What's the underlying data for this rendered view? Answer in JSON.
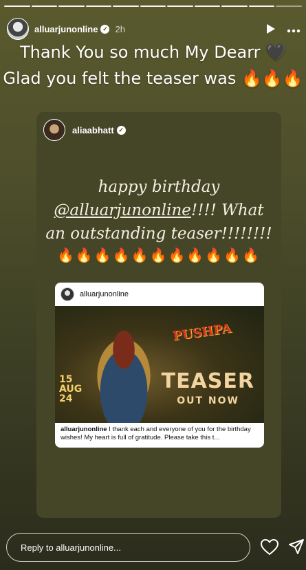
{
  "story": {
    "progress": {
      "segments": 11,
      "active_segment": 11
    },
    "author": {
      "username": "alluarjunonline",
      "verified": true,
      "time_ago": "2h",
      "avatar_icon": "avatar-icon"
    },
    "controls": {
      "play_icon": "play-icon",
      "more_icon": "more-options-icon"
    },
    "overlay": {
      "line1": "Thank You so much My Dearr 🖤",
      "line2": "Glad you felt the teaser was 🔥🔥🔥"
    },
    "shared_post": {
      "author": {
        "username": "aliaabhatt",
        "verified": true
      },
      "message": {
        "line1": "happy birthday",
        "mention": "@alluarjunonline",
        "line2_suffix": "!!!! What",
        "line3": "an outstanding teaser!!!!!!!!",
        "emojis": "🔥🔥🔥🔥🔥🔥🔥🔥🔥🔥🔥"
      },
      "embedded_post": {
        "username": "alluarjunonline",
        "poster": {
          "date_lines": [
            "15",
            "AUG",
            "24"
          ],
          "logo": "PUSHPA",
          "headline": "TEASER",
          "subheadline": "OUT NOW"
        },
        "caption_user": "alluarjunonline",
        "caption_text": "I thank each and everyone of you for the birthday wishes! My heart is full of gratitude. Please take this t..."
      }
    },
    "reply": {
      "placeholder": "Reply to alluarjunonline..."
    },
    "actions": {
      "like_icon": "heart-icon",
      "share_icon": "send-icon"
    },
    "colors": {
      "background": "#4e4f2b",
      "card": "#454628"
    }
  }
}
